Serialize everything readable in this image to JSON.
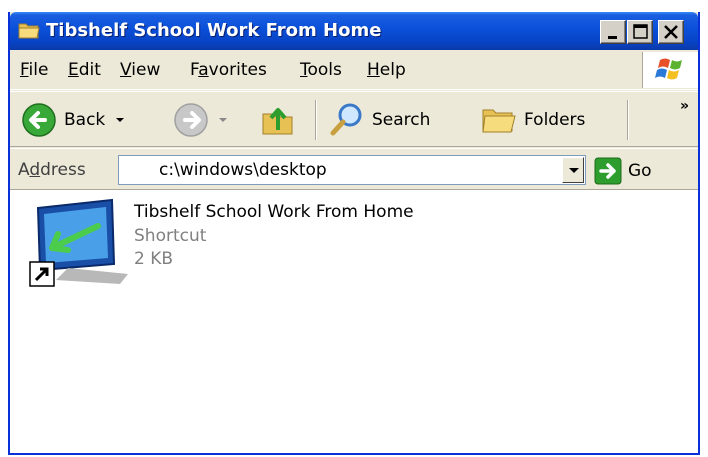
{
  "window": {
    "title": "Tibshelf School Work From Home"
  },
  "menu": [
    {
      "label": "File",
      "key": "F",
      "rest": "ile"
    },
    {
      "label": "Edit",
      "key": "E",
      "rest": "dit"
    },
    {
      "label": "View",
      "key": "V",
      "rest": "iew"
    },
    {
      "label": "Favorites",
      "pre": "F",
      "key": "a",
      "rest": "vorites"
    },
    {
      "label": "Tools",
      "key": "T",
      "rest": "ools"
    },
    {
      "label": "Help",
      "key": "H",
      "rest": "elp"
    }
  ],
  "toolbar": {
    "back_label": "Back",
    "search_label": "Search",
    "folders_label": "Folders",
    "overflow": "»"
  },
  "address": {
    "label_pre": "A",
    "label_key": "d",
    "label_rest": "dress",
    "value": "c:\\windows\\desktop",
    "go_label": "Go"
  },
  "file": {
    "name": "Tibshelf School Work From Home",
    "type": "Shortcut",
    "size": "2 KB"
  },
  "colors": {
    "titlebar": "#0a4fd8",
    "chrome": "#ece9d8",
    "go_green": "#2d9d2d",
    "nav_green": "#38a838"
  }
}
